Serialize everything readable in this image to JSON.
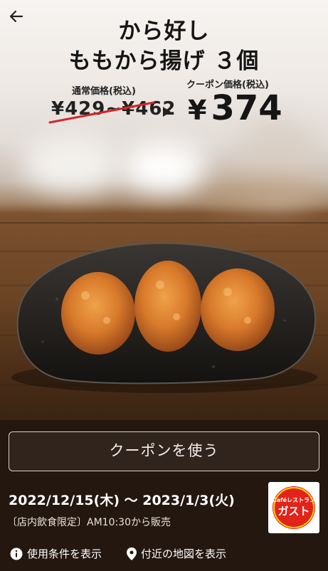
{
  "header": {
    "title_line1": "から好し",
    "title_line2": "ももから揚げ ３個"
  },
  "pricing": {
    "regular_label": "通常価格(税込)",
    "regular_price": "¥429~¥462",
    "coupon_label": "クーポン価格(税込)",
    "coupon_currency": "¥",
    "coupon_price": "374"
  },
  "actions": {
    "use_coupon_label": "クーポンを使う",
    "terms_link": "使用条件を表示",
    "map_link": "付近の地図を表示"
  },
  "details": {
    "period": "2022/12/15(木) 〜 2023/1/3(火)",
    "note": "〔店内飲食限定〕AM10:30から販売"
  },
  "brand": {
    "logo_top": "Caféレストラン",
    "logo_main": "ガスト"
  },
  "icons": {
    "back": "back-arrow-icon",
    "info": "info-icon",
    "location": "location-pin-icon"
  },
  "colors": {
    "strike_red": "#d2262a",
    "logo_red": "#e2231a",
    "bottom_bg": "#24170f"
  }
}
